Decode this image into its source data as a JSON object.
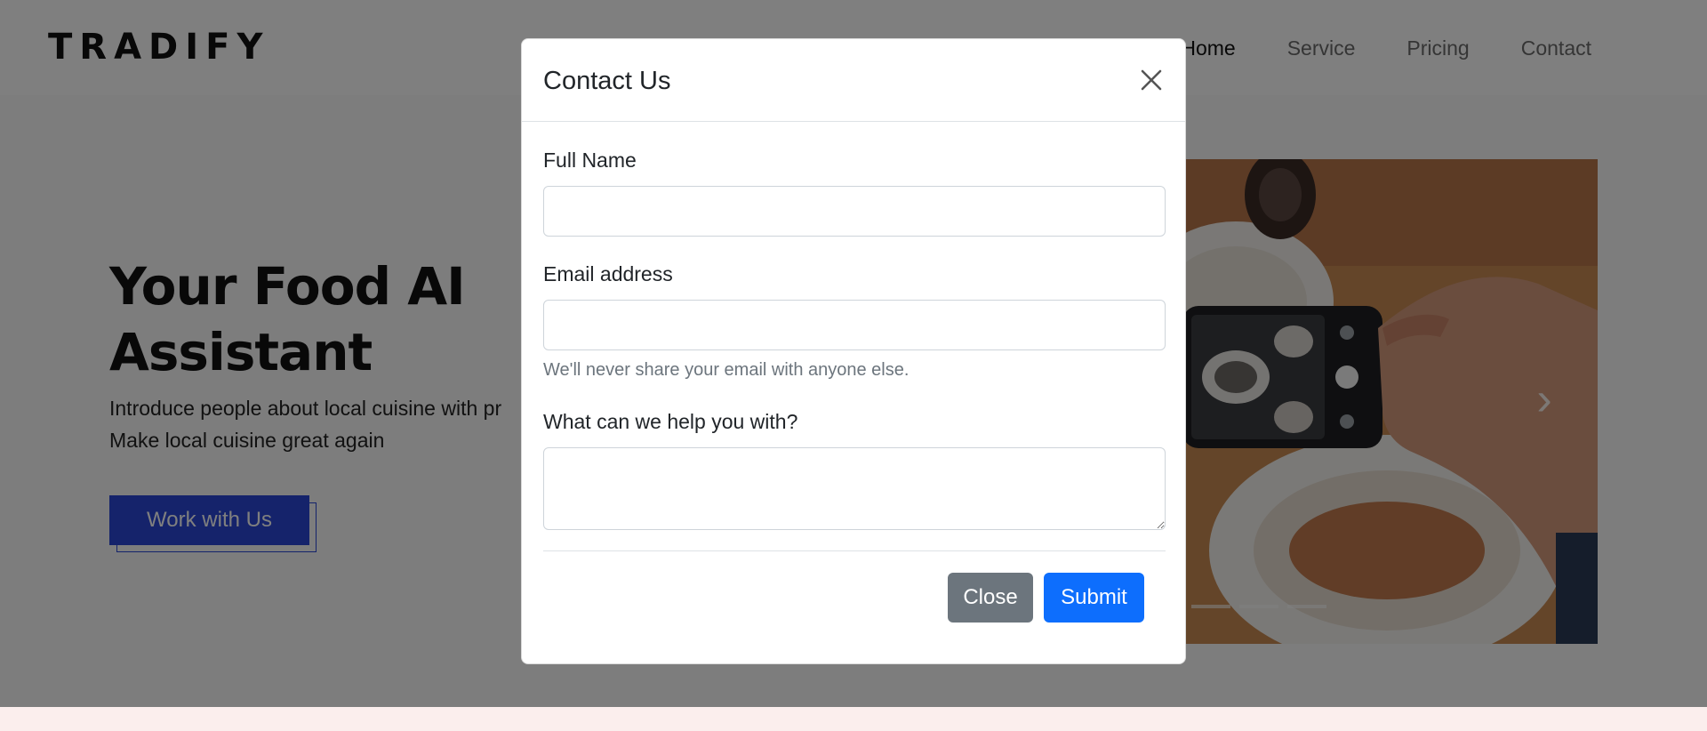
{
  "navbar": {
    "brand": "TRADIFY",
    "links": [
      {
        "label": "Home",
        "active": true
      },
      {
        "label": "Service",
        "active": false
      },
      {
        "label": "Pricing",
        "active": false
      },
      {
        "label": "Contact",
        "active": false
      }
    ]
  },
  "hero": {
    "title": "Your Food AI Assistant",
    "subtitle_line1": "Introduce people about local cuisine with pr",
    "subtitle_line2": "Make local cuisine great again",
    "cta_label": "Work with Us",
    "carousel": {
      "image_alt": "Hand photographing food plates with smartphone",
      "next_icon": "chevron-right-icon",
      "indicator_count": 3
    }
  },
  "modal": {
    "title": "Contact Us",
    "close_icon": "close-icon",
    "fields": {
      "full_name": {
        "label": "Full Name",
        "value": "",
        "placeholder": ""
      },
      "email": {
        "label": "Email address",
        "value": "",
        "placeholder": "",
        "help": "We'll never share your email with anyone else."
      },
      "message": {
        "label": "What can we help you with?",
        "value": "",
        "placeholder": ""
      }
    },
    "buttons": {
      "close": "Close",
      "submit": "Submit"
    }
  },
  "colors": {
    "primary": "#0d6efd",
    "secondary": "#6c757d",
    "brand_blue": "#2a47d6",
    "backdrop": "rgba(0,0,0,0.5)",
    "footer_band": "#fbeeed"
  }
}
